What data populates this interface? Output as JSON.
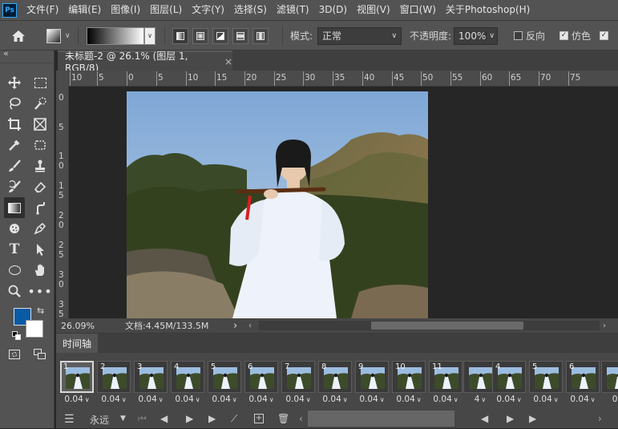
{
  "menu": {
    "logo": "Ps",
    "items": [
      "文件(F)",
      "编辑(E)",
      "图像(I)",
      "图层(L)",
      "文字(Y)",
      "选择(S)",
      "滤镜(T)",
      "3D(D)",
      "视图(V)",
      "窗口(W)",
      "关于Photoshop(H)"
    ]
  },
  "options": {
    "mode_label": "模式:",
    "mode_value": "正常",
    "opacity_label": "不透明度:",
    "opacity_value": "100%",
    "reverse_label": "反向",
    "reverse_checked": false,
    "dither_label": "仿色",
    "dither_checked": true
  },
  "panel_collapse": "«",
  "document": {
    "tab_title": "未标题-2 @ 26.1% (图层 1, RGB/8)",
    "close_glyph": "×"
  },
  "ruler": {
    "top_labels": [
      "10",
      "5",
      "0",
      "5",
      "10",
      "15",
      "20",
      "25",
      "30",
      "35",
      "40",
      "45",
      "50",
      "55",
      "60",
      "65",
      "70",
      "75"
    ],
    "left_labels": [
      "0",
      "5",
      "1\n0",
      "1\n5",
      "2\n0",
      "2\n5",
      "3\n0",
      "3\n5"
    ]
  },
  "status": {
    "zoom": "26.09%",
    "doc_size": "文档:4.45M/133.5M",
    "arrow": "›"
  },
  "timeline": {
    "tab_label": "时间轴",
    "frames": [
      {
        "num": "1",
        "delay": "0.04"
      },
      {
        "num": "2",
        "delay": "0.04"
      },
      {
        "num": "3",
        "delay": "0.04"
      },
      {
        "num": "4",
        "delay": "0.04"
      },
      {
        "num": "5",
        "delay": "0.04"
      },
      {
        "num": "6",
        "delay": "0.04"
      },
      {
        "num": "7",
        "delay": "0.04"
      },
      {
        "num": "8",
        "delay": "0.04"
      },
      {
        "num": "9",
        "delay": "0.04"
      },
      {
        "num": "10",
        "delay": "0.04"
      },
      {
        "num": "11",
        "delay": "0.04"
      },
      {
        "num": "",
        "delay": "4"
      },
      {
        "num": "4",
        "delay": "0.04"
      },
      {
        "num": "5",
        "delay": "0.04"
      },
      {
        "num": "6",
        "delay": "0.04"
      },
      {
        "num": "",
        "delay": "0"
      }
    ],
    "loop_label": "永远"
  },
  "colors": {
    "foreground": "#0b5aa6",
    "background": "#ffffff",
    "sky": "#8fb4d9",
    "mountain": "#5a6a3a",
    "dress": "#eef2fa"
  }
}
